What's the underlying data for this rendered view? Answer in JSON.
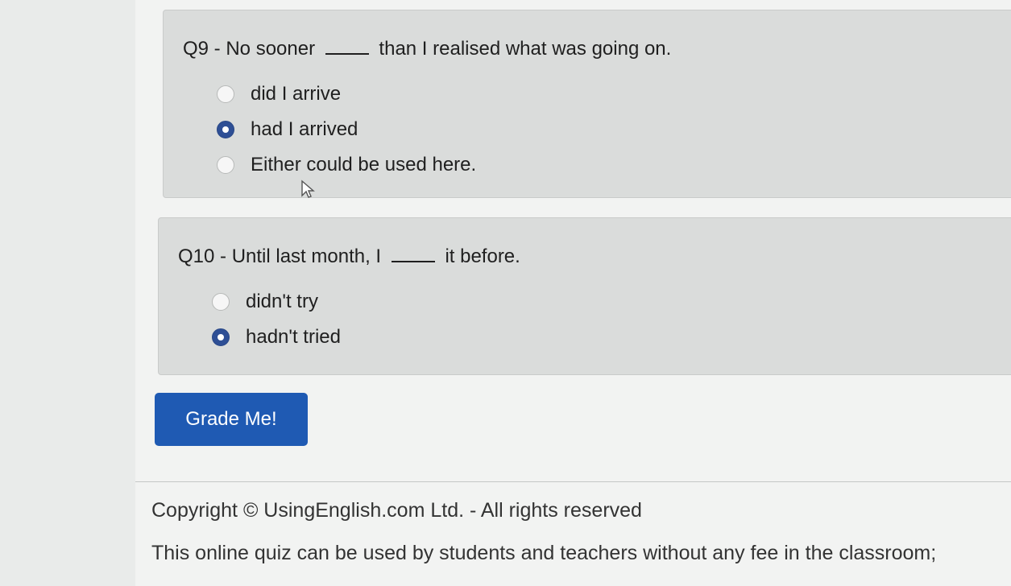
{
  "questions": [
    {
      "prompt_prefix": "Q9 - No sooner",
      "prompt_suffix": "than I realised what was going on.",
      "options": [
        {
          "label": "did I arrive",
          "selected": false
        },
        {
          "label": "had I arrived",
          "selected": true
        },
        {
          "label": "Either could be used here.",
          "selected": false
        }
      ]
    },
    {
      "prompt_prefix": "Q10 - Until last month, I",
      "prompt_suffix": "it before.",
      "options": [
        {
          "label": "didn't try",
          "selected": false
        },
        {
          "label": "hadn't tried",
          "selected": true
        }
      ]
    }
  ],
  "actions": {
    "grade_label": "Grade Me!"
  },
  "footer": {
    "copyright": "Copyright © UsingEnglish.com Ltd. - All rights reserved",
    "usage": "This online quiz can be used by students and teachers without any fee in the classroom;"
  },
  "colors": {
    "selected_radio": "#2e4f95",
    "grade_button": "#1f5ab3"
  },
  "icons": {
    "pointer": "mouse-pointer-icon"
  }
}
